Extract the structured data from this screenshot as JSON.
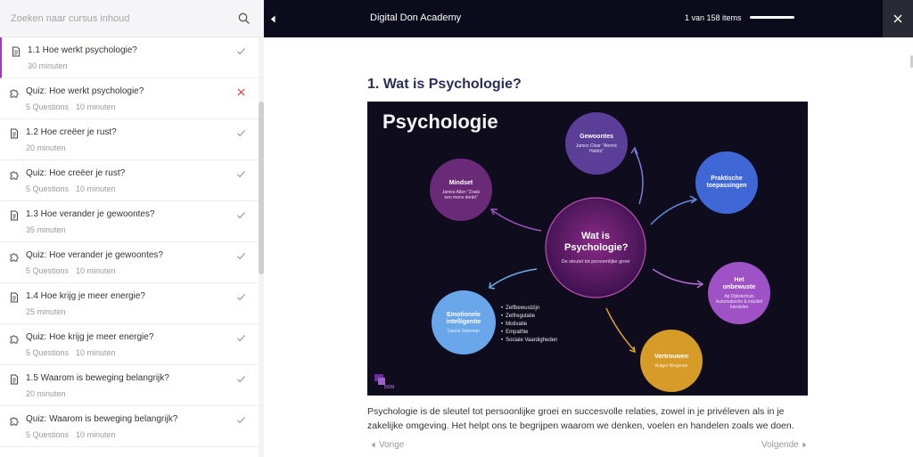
{
  "search": {
    "placeholder": "Zoeken naar cursus inhoud"
  },
  "sidebar": {
    "items": [
      {
        "title": "1.1 Hoe werkt psychologie?",
        "type": "lesson",
        "duration": "30 minuten",
        "status": "done"
      },
      {
        "title": "Quiz: Hoe werkt psychologie?",
        "type": "quiz",
        "questions": "5 Questions",
        "duration": "10 minuten",
        "status": "failed"
      },
      {
        "title": "1.2 Hoe creëer je rust?",
        "type": "lesson",
        "duration": "20 minuten",
        "status": "done"
      },
      {
        "title": "Quiz: Hoe creëer je rust?",
        "type": "quiz",
        "questions": "5 Questions",
        "duration": "10 minuten",
        "status": "done"
      },
      {
        "title": "1.3 Hoe verander je gewoontes?",
        "type": "lesson",
        "duration": "35 minuten",
        "status": "done"
      },
      {
        "title": "Quiz: Hoe verander je gewoontes?",
        "type": "quiz",
        "questions": "5 Questions",
        "duration": "10 minuten",
        "status": "done"
      },
      {
        "title": "1.4 Hoe krijg je meer energie?",
        "type": "lesson",
        "duration": "25 minuten",
        "status": "done"
      },
      {
        "title": "Quiz: Hoe krijg je meer energie?",
        "type": "quiz",
        "questions": "5 Questions",
        "duration": "10 minuten",
        "status": "done"
      },
      {
        "title": "1.5 Waarom is beweging belangrijk?",
        "type": "lesson",
        "duration": "20 minuten",
        "status": "done"
      },
      {
        "title": "Quiz: Waarom is beweging belangrijk?",
        "type": "quiz",
        "questions": "5 Questions",
        "duration": "10 minuten",
        "status": "done"
      }
    ]
  },
  "topbar": {
    "brand": "Digital Don Academy",
    "counter": "1 van 158 items",
    "progress_fraction": 0.006
  },
  "lesson": {
    "title": "1. Wat is Psychologie?",
    "body": "Psychologie is de sleutel tot persoonlijke groei en succesvolle relaties, zowel in je privéleven als in je zakelijke omgeving. Het helpt ons te begrijpen waarom we denken, voelen en handelen zoals we doen.",
    "prev_label": "Vorige",
    "next_label": "Volgende"
  },
  "figure": {
    "heading": "Psychologie",
    "center": {
      "title": "Wat is Psychologie?",
      "sub": "De sleutel tot persoonlijke groei"
    },
    "gewoontes": {
      "title": "Gewoontes",
      "sub": "James Clear \"Atomic Habits\""
    },
    "mindset": {
      "title": "Mindset",
      "sub": "James Allen \"Zoals een mens denkt\""
    },
    "praktische": {
      "title": "Praktische toepassingen"
    },
    "onbewuste": {
      "title": "Het onbewuste",
      "sub": "Ap Dijksterhuis Automatische & intuïtief handelen"
    },
    "vertrouwen": {
      "title": "Vertrouwen",
      "sub": "Rutger Bregman"
    },
    "emotionele": {
      "title": "Emotionele intelligentie",
      "sub": "Daniel Goleman"
    },
    "bullets": [
      "Zelfbewustzijn",
      "Zelfregulatie",
      "Motivatie",
      "Empathie",
      "Sociale Vaardigheden"
    ],
    "logo_text": "DON"
  },
  "colors": {
    "topbar": "#0b0b1c",
    "accent": "#a03ac4",
    "title": "#2b2d5c",
    "check": "#9a9a9a",
    "fail": "#d9534f"
  }
}
